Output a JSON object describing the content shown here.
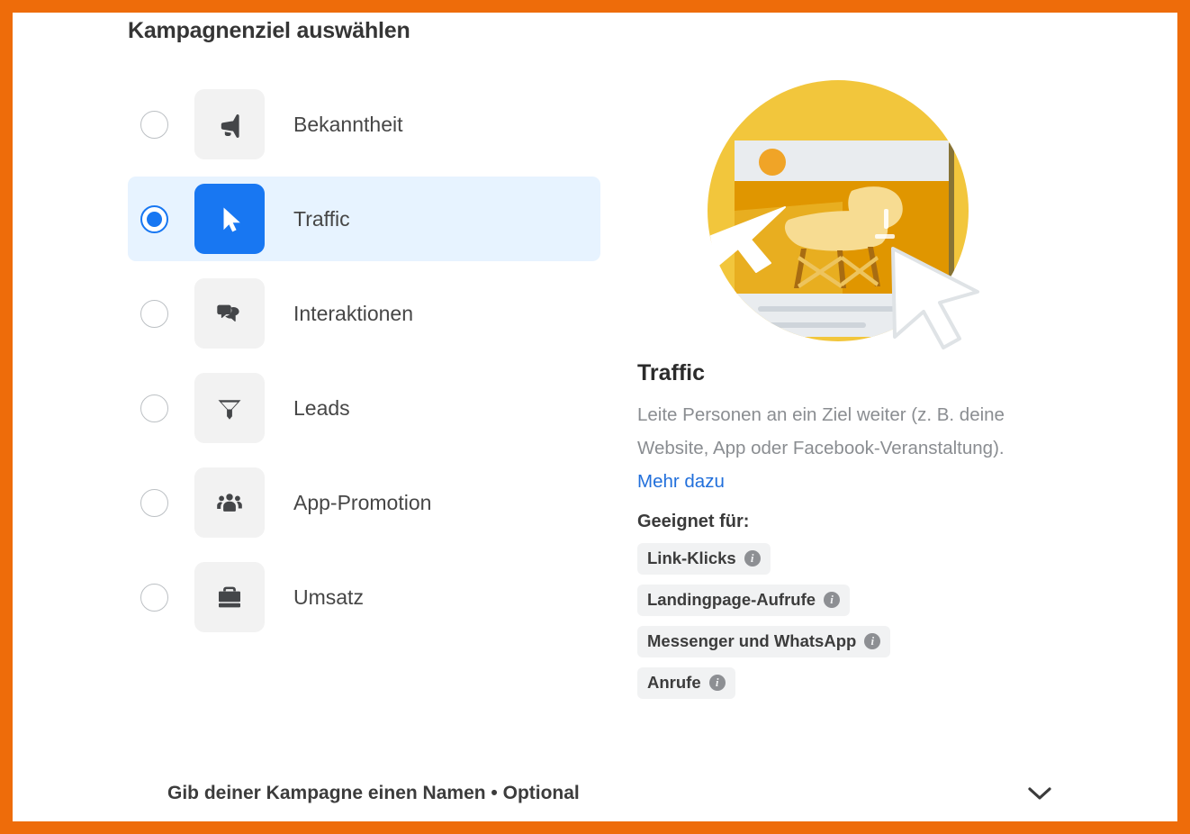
{
  "page": {
    "title": "Kampagnenziel auswählen",
    "frame_color": "#ee6c0a",
    "accent_color": "#1877f2",
    "selected_row_bg": "#e7f3ff"
  },
  "objectives": [
    {
      "label": "Bekanntheit",
      "icon": "megaphone-icon",
      "selected": false
    },
    {
      "label": "Traffic",
      "icon": "cursor-arrow-icon",
      "selected": true
    },
    {
      "label": "Interaktionen",
      "icon": "speech-bubbles-icon",
      "selected": false
    },
    {
      "label": "Leads",
      "icon": "funnel-icon",
      "selected": false
    },
    {
      "label": "App-Promotion",
      "icon": "people-group-icon",
      "selected": false
    },
    {
      "label": "Umsatz",
      "icon": "briefcase-icon",
      "selected": false
    }
  ],
  "detail": {
    "title": "Traffic",
    "description": "Leite Personen an ein Ziel weiter (z. B. deine Website, App oder Facebook-Veranstaltung). ",
    "link_label": "Mehr dazu",
    "suited_heading": "Geeignet für:",
    "tags": [
      {
        "label": "Link-Klicks",
        "info": "i"
      },
      {
        "label": "Landingpage-Aufrufe",
        "info": "i"
      },
      {
        "label": "Messenger und WhatsApp",
        "info": "i"
      },
      {
        "label": "Anrufe",
        "info": "i"
      }
    ],
    "illustration": {
      "name": "traffic-illustration",
      "circle_color": "#f2c63c",
      "card_header_color": "#e9ecef",
      "card_body_color": "#e09600",
      "chair_color": "#f7dc92",
      "accent_dot_color": "#f0a427"
    }
  },
  "campaign_name": {
    "label": "Gib deiner Kampagne einen Namen • Optional",
    "chevron": "chevron-down-icon"
  }
}
